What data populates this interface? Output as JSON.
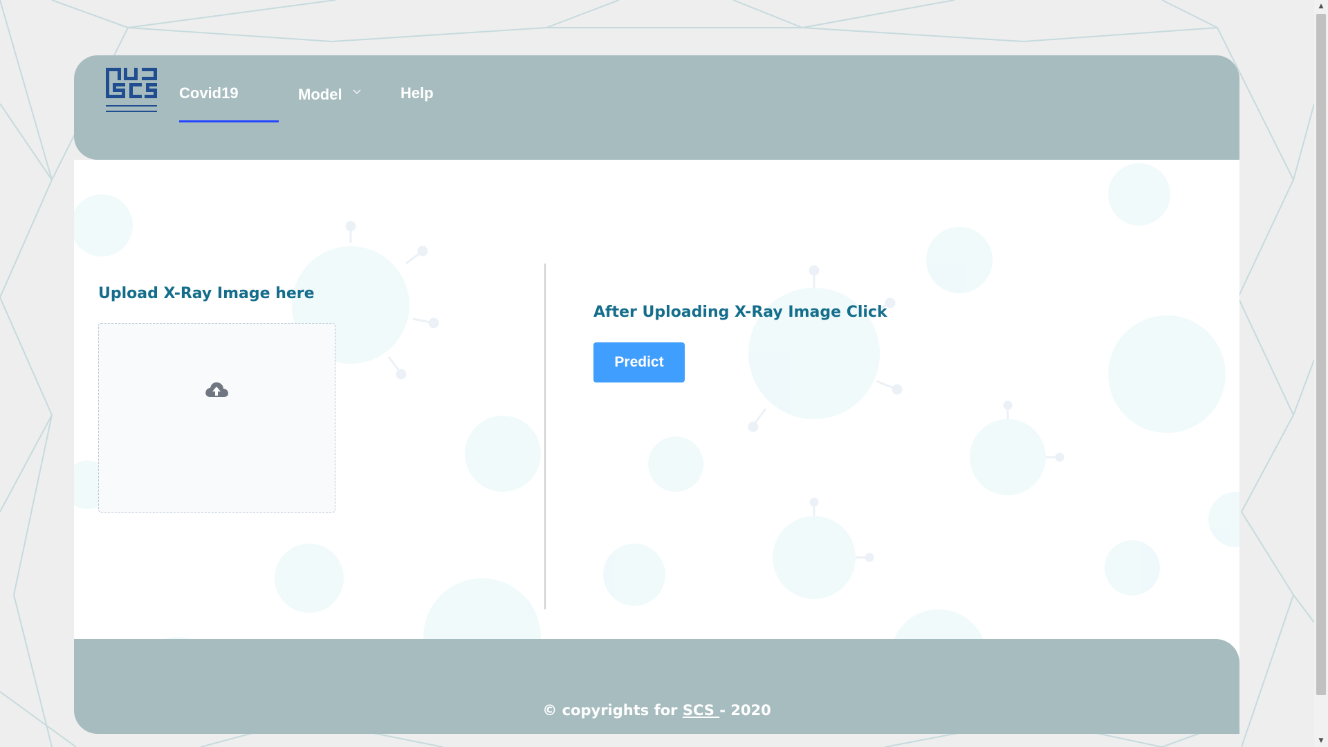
{
  "colors": {
    "header_bg": "#a7bcbf",
    "accent_blue": "#409eff",
    "title_teal": "#146d8b",
    "nav_active_underline": "#2546ff"
  },
  "header": {
    "logo_icon": "scs-logo-icon",
    "nav": [
      {
        "label": "Covid19",
        "active": true
      },
      {
        "label": "Model",
        "has_dropdown": true,
        "dropdown_icon": "chevron-down-icon"
      },
      {
        "label": "Help"
      }
    ]
  },
  "upload": {
    "title": "Upload X-Ray Image here",
    "icon": "cloud-upload-icon"
  },
  "predict": {
    "title": "After Uploading X-Ray Image Click",
    "button_label": "Predict"
  },
  "footer": {
    "prefix": "© copyrights for ",
    "link_text": "SCS ",
    "suffix": "- 2020"
  }
}
